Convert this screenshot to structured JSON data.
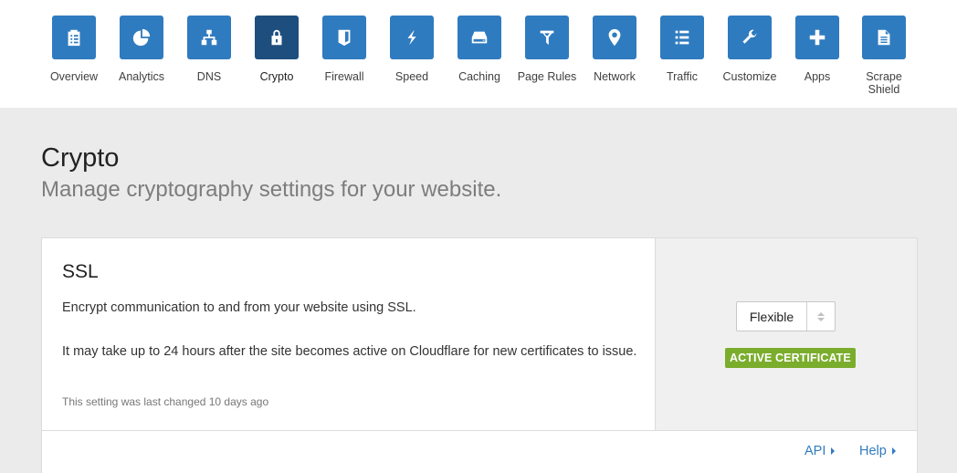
{
  "nav": {
    "items": [
      {
        "label": "Overview",
        "icon": "clipboard-list-icon",
        "active": false
      },
      {
        "label": "Analytics",
        "icon": "pie-chart-icon",
        "active": false
      },
      {
        "label": "DNS",
        "icon": "sitemap-icon",
        "active": false
      },
      {
        "label": "Crypto",
        "icon": "lock-icon",
        "active": true
      },
      {
        "label": "Firewall",
        "icon": "shield-icon",
        "active": false
      },
      {
        "label": "Speed",
        "icon": "lightning-icon",
        "active": false
      },
      {
        "label": "Caching",
        "icon": "hard-drive-icon",
        "active": false
      },
      {
        "label": "Page Rules",
        "icon": "funnel-icon",
        "active": false
      },
      {
        "label": "Network",
        "icon": "map-pin-icon",
        "active": false
      },
      {
        "label": "Traffic",
        "icon": "list-icon",
        "active": false
      },
      {
        "label": "Customize",
        "icon": "wrench-icon",
        "active": false
      },
      {
        "label": "Apps",
        "icon": "plus-icon",
        "active": false
      },
      {
        "label": "Scrape Shield",
        "icon": "document-icon",
        "active": false
      }
    ],
    "colors": {
      "tile": "#2f7bbf",
      "tile_active": "#1d4e7e"
    }
  },
  "page": {
    "title": "Crypto",
    "subtitle": "Manage cryptography settings for your website."
  },
  "ssl_card": {
    "title": "SSL",
    "description": "Encrypt communication to and from your website using SSL.",
    "note": "It may take up to 24 hours after the site becomes active on Cloudflare for new certificates to issue.",
    "meta": "This setting was last changed 10 days ago",
    "select": {
      "value": "Flexible"
    },
    "badge": {
      "label": "ACTIVE CERTIFICATE",
      "color": "#7bad2d"
    },
    "footer": {
      "api_label": "API",
      "help_label": "Help"
    }
  }
}
